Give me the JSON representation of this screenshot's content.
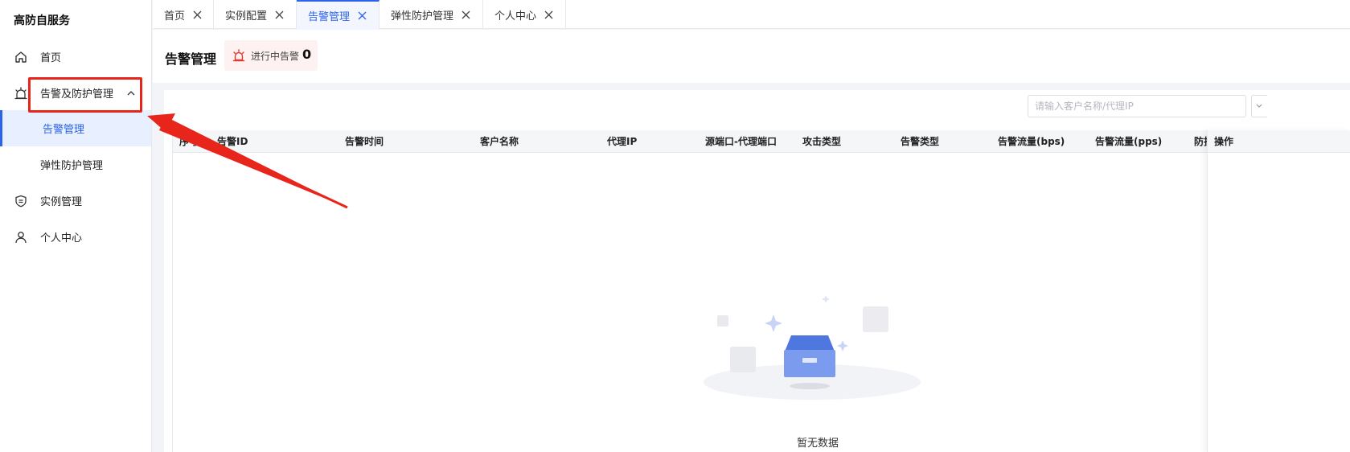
{
  "sidebar": {
    "brand": "高防自服务",
    "items": [
      {
        "label": "首页",
        "icon": "home-icon"
      },
      {
        "label": "告警及防护管理",
        "icon": "alarm-icon"
      },
      {
        "label": "告警管理"
      },
      {
        "label": "弹性防护管理"
      },
      {
        "label": "实例管理",
        "icon": "shield-icon"
      },
      {
        "label": "个人中心",
        "icon": "user-icon"
      }
    ]
  },
  "tabs": [
    {
      "label": "首页"
    },
    {
      "label": "实例配置"
    },
    {
      "label": "告警管理"
    },
    {
      "label": "弹性防护管理"
    },
    {
      "label": "个人中心"
    }
  ],
  "header": {
    "title": "告警管理",
    "alert_label": "进行中告警",
    "alert_count": "0"
  },
  "toolbar": {
    "search_placeholder": "请输入客户名称/代理IP"
  },
  "table": {
    "columns": [
      "序号",
      "告警ID",
      "告警时间",
      "客户名称",
      "代理IP",
      "源端口-代理端口",
      "攻击类型",
      "告警类型",
      "告警流量(bps)",
      "告警流量(pps)",
      "防护"
    ],
    "fixed_column": "操作",
    "empty_text": "暂无数据"
  },
  "colors": {
    "accent": "#2c63e8",
    "annotation": "#e8251b",
    "alert_bg": "#fdf1f1"
  }
}
